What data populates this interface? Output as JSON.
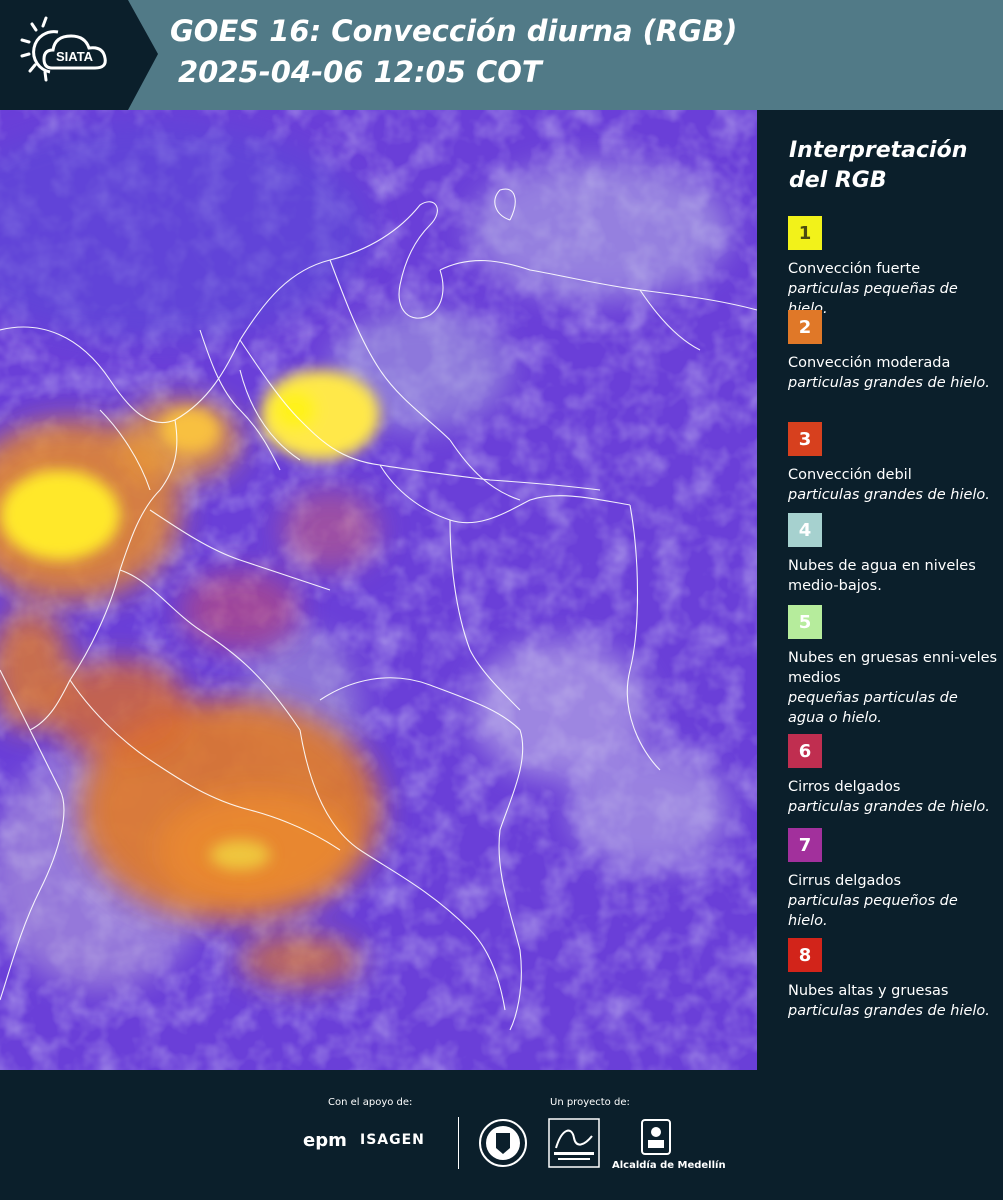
{
  "header": {
    "logo_text": "SIATA",
    "title_line1": "GOES 16: Convección diurna (RGB)",
    "title_line2": "2025-04-06 12:05 COT"
  },
  "colors": {
    "header_bg": "#517a87",
    "panel_bg": "#0b1f2b",
    "map_base": "#6a3fd8"
  },
  "legend": {
    "title": "Interpretación del RGB",
    "items": [
      {
        "number": "1",
        "color": "#f2f21a",
        "number_color": "#4a4a10",
        "label": "Convección fuerte",
        "sublabel": "particulas pequeñas de hielo."
      },
      {
        "number": "2",
        "color": "#e07828",
        "number_color": "#ffffff",
        "label": "Convección moderada",
        "sublabel": "particulas grandes de hielo."
      },
      {
        "number": "3",
        "color": "#d7401e",
        "number_color": "#ffffff",
        "label": "Convección debil",
        "sublabel": "particulas grandes de hielo."
      },
      {
        "number": "4",
        "color": "#a6d1cf",
        "number_color": "#ffffff",
        "label": "Nubes de agua en niveles medio-bajos.",
        "sublabel": ""
      },
      {
        "number": "5",
        "color": "#b6ec9c",
        "number_color": "#ffffff",
        "label": "Nubes en gruesas enni-veles medios",
        "sublabel": "pequeñas particulas de agua o hielo."
      },
      {
        "number": "6",
        "color": "#c02e50",
        "number_color": "#ffffff",
        "label": "Cirros delgados",
        "sublabel": "particulas grandes de hielo."
      },
      {
        "number": "7",
        "color": "#a2309c",
        "number_color": "#ffffff",
        "label": "Cirrus delgados",
        "sublabel": "particulas pequeños de hielo."
      },
      {
        "number": "8",
        "color": "#d2241a",
        "number_color": "#ffffff",
        "label": "Nubes altas y gruesas",
        "sublabel": "particulas grandes de hielo."
      }
    ]
  },
  "footer": {
    "support_label": "Con el apoyo de:",
    "project_label": "Un proyecto de:",
    "sponsor_logos": [
      "epm",
      "ISAGEN"
    ],
    "partner_logo_text": "Alcaldía de Medellín",
    "partner_logos": [
      "seal-logo",
      "area-metropolitana-logo",
      "alcaldia-medellin-logo"
    ]
  }
}
